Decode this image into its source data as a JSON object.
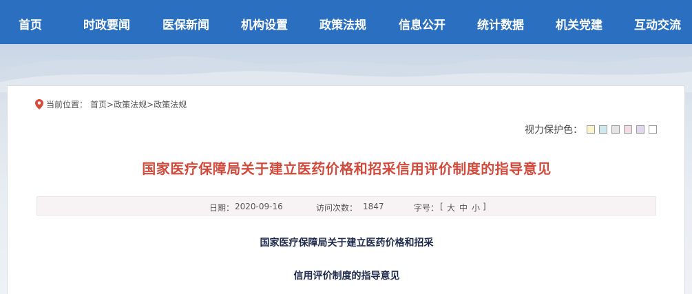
{
  "nav": {
    "items": [
      {
        "label": "首页"
      },
      {
        "label": "时政要闻"
      },
      {
        "label": "医保新闻"
      },
      {
        "label": "机构设置"
      },
      {
        "label": "政策法规"
      },
      {
        "label": "信息公开"
      },
      {
        "label": "统计数据"
      },
      {
        "label": "机关党建"
      },
      {
        "label": "互动交流"
      }
    ],
    "background": "#2a6fc0"
  },
  "breadcrumb": {
    "prefix": "当前位置：",
    "items": [
      "首页",
      ">",
      "政策法规",
      ">",
      "政策法规"
    ]
  },
  "vision": {
    "label": "视力保护色：",
    "swatches": [
      "#fbf5c8",
      "#cde8ee",
      "#e4e4e4",
      "#f4dbe6",
      "#e0d6f0",
      "#ffffff"
    ]
  },
  "article": {
    "title": "国家医疗保障局关于建立医药价格和招采信用评价制度的指导意见",
    "title_color": "#d14a3c",
    "date_label": "日期：",
    "date": "2020-09-16",
    "visits_label": "访问次数：",
    "visits": "1847",
    "font_label": "字号：",
    "font_open": "[",
    "font_large": "大",
    "font_medium": "中",
    "font_small": "小",
    "font_close": "]",
    "subtitle_line1": "国家医疗保障局关于建立医药价格和招采",
    "subtitle_line2": "信用评价制度的指导意见"
  }
}
